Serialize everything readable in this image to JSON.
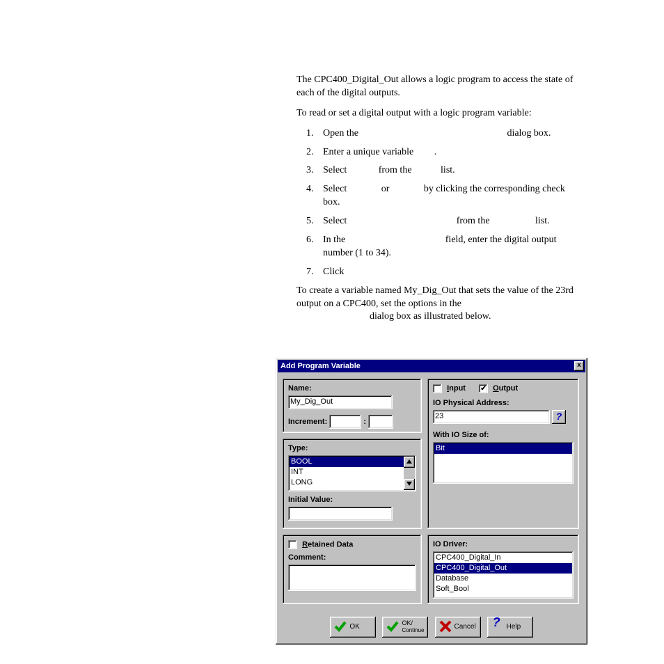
{
  "doc": {
    "intro": "The CPC400_Digital_Out allows a logic program to access the state of each of the digital outputs.",
    "lead": "To read or set a digital output with a logic program variable:",
    "steps": {
      "s1a": "Open the ",
      "s1b": " dialog box.",
      "s2a": "Enter a unique variable ",
      "s2b": ".",
      "s3a": "Select ",
      "s3b": " from the ",
      "s3c": " list.",
      "s4a": "Select ",
      "s4b": " or ",
      "s4c": " by clicking the corresponding check box.",
      "s5a": "Select ",
      "s5b": " from the ",
      "s5c": " list.",
      "s6a": "In the ",
      "s6b": " field, enter the digital output number (1 to 34).",
      "s7a": "Click "
    },
    "example_a": "To create a variable named My_Dig_Out that sets the value of the 23rd output on a CPC400, set the options in the ",
    "example_b": " dialog box as illustrated below."
  },
  "dialog": {
    "title": "Add Program Variable",
    "name_label": "Name:",
    "name_value": "My_Dig_Out",
    "increment_label": "Increment:",
    "colon": ":",
    "type_label": "Type:",
    "type_items": [
      "BOOL",
      "INT",
      "LONG"
    ],
    "initial_value_label": "Initial Value:",
    "retained_label_pre": "R",
    "retained_label_rest": "etained Data",
    "comment_label": "Comment:",
    "input_label_pre": "I",
    "input_label_rest": "nput",
    "output_label_pre": "O",
    "output_label_rest": "utput",
    "output_checked": "✔",
    "io_addr_label": "IO Physical Address:",
    "io_addr_value": "23",
    "help_q": "?",
    "io_size_label": "With IO Size of:",
    "io_size_items": [
      "Bit"
    ],
    "io_driver_label": "IO Driver:",
    "io_driver_items": [
      "CPC400_Digital_In",
      "CPC400_Digital_Out",
      "Database",
      "Soft_Bool"
    ],
    "btn_ok": "OK",
    "btn_okc": "OK/",
    "btn_okc_sub": "Continue",
    "btn_cancel": "Cancel",
    "btn_help": "Help",
    "close_x": "x"
  }
}
